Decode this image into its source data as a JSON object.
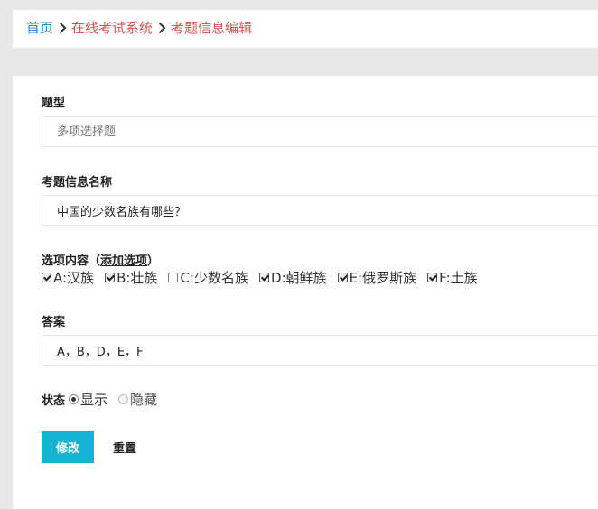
{
  "breadcrumb": {
    "home": "首页",
    "section": "在线考试系统",
    "current": "考题信息编辑"
  },
  "form": {
    "type_label": "题型",
    "type_placeholder": "多项选择题",
    "name_label": "考题信息名称",
    "name_value": "中国的少数名族有哪些？",
    "options_label": "选项内容",
    "add_option_open": "（",
    "add_option_label": "添加选项",
    "add_option_close": "）",
    "options": [
      {
        "label": "A:汉族",
        "checked": true
      },
      {
        "label": "B:壮族",
        "checked": true
      },
      {
        "label": "C:少数名族",
        "checked": false
      },
      {
        "label": "D:朝鲜族",
        "checked": true
      },
      {
        "label": "E:俄罗斯族",
        "checked": true
      },
      {
        "label": "F:土族",
        "checked": true
      }
    ],
    "answer_label": "答案",
    "answer_value": "A，B，D，E，F",
    "status_label": "状态",
    "status_options": [
      {
        "label": "显示",
        "checked": true
      },
      {
        "label": "隐藏",
        "checked": false
      }
    ],
    "submit_label": "修改",
    "reset_label": "重置"
  },
  "colors": {
    "home_link": "#1e88c9",
    "crumb_link": "#d9534f",
    "primary_button": "#17b3d2",
    "page_background": "#e8e8e8"
  }
}
